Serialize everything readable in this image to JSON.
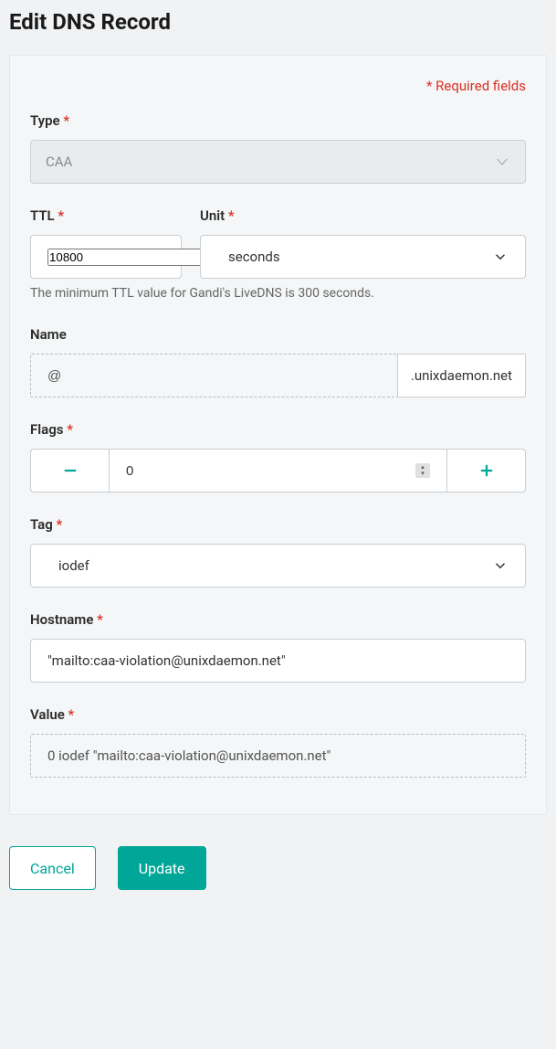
{
  "page_title": "Edit DNS Record",
  "required_fields_label": "* Required fields",
  "type": {
    "label": "Type",
    "value": "CAA"
  },
  "ttl": {
    "label": "TTL",
    "value": "10800",
    "unit_label": "Unit",
    "unit_value": "seconds",
    "hint": "The minimum TTL value for Gandi's LiveDNS is 300 seconds."
  },
  "name": {
    "label": "Name",
    "value": "@",
    "suffix": ".unixdaemon.net"
  },
  "flags": {
    "label": "Flags",
    "value": "0"
  },
  "tag": {
    "label": "Tag",
    "value": "iodef"
  },
  "hostname": {
    "label": "Hostname",
    "value": "\"mailto:caa-violation@unixdaemon.net\""
  },
  "value": {
    "label": "Value",
    "computed": "0 iodef \"mailto:caa-violation@unixdaemon.net\""
  },
  "actions": {
    "cancel": "Cancel",
    "update": "Update"
  }
}
